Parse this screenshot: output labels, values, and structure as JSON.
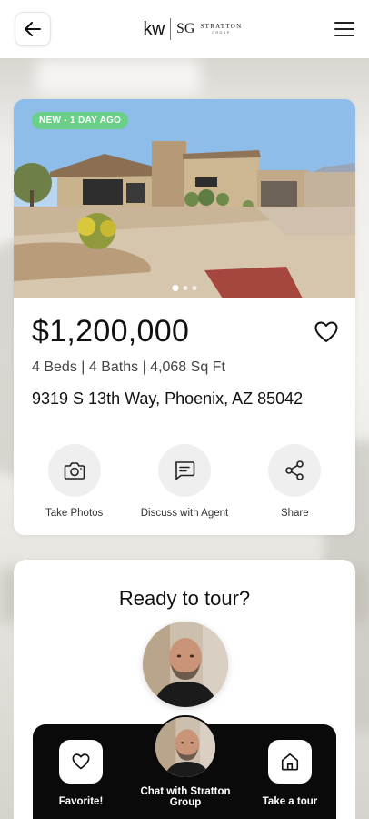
{
  "header": {
    "back_icon": "arrow-left-icon",
    "logo": {
      "kw": "kw",
      "monogram": "SG",
      "brand_name": "STRATTON",
      "brand_sub": "GROUP"
    },
    "menu_icon": "hamburger-icon"
  },
  "listing": {
    "badge": "NEW - 1 DAY AGO",
    "photo_count": 3,
    "active_photo": 1,
    "price": "$1,200,000",
    "specs": "4 Beds | 4 Baths | 4,068 Sq Ft",
    "address": "9319 S 13th Way, Phoenix, AZ 85042",
    "actions": [
      {
        "label": "Take Photos",
        "icon": "camera-icon"
      },
      {
        "label": "Discuss with Agent",
        "icon": "chat-bubble-icon"
      },
      {
        "label": "Share",
        "icon": "share-icon"
      }
    ]
  },
  "tour": {
    "title": "Ready to tour?"
  },
  "bottom_bar": {
    "favorite_label": "Favorite!",
    "chat_label": "Chat with Stratton Group",
    "tour_label": "Take a tour"
  },
  "colors": {
    "badge_green": "#6ad088",
    "bottom_bar_bg": "#0a0a0a",
    "icon_circle_bg": "#efefef"
  }
}
